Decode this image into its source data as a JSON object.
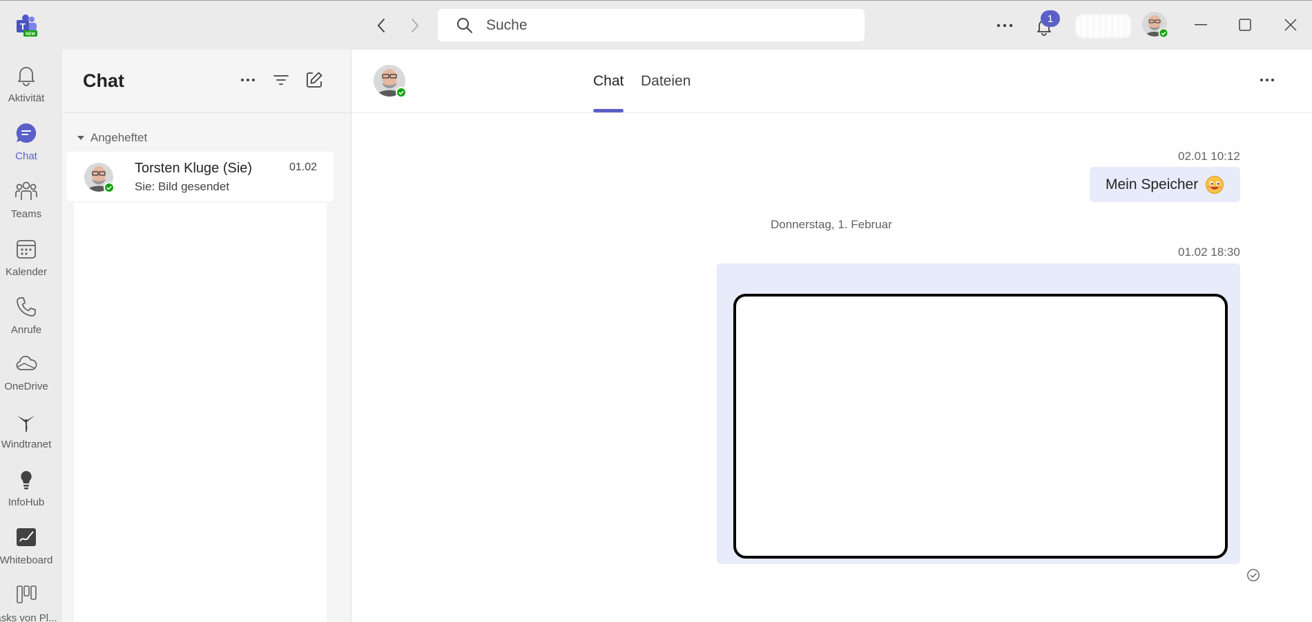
{
  "titlebar": {
    "search_placeholder": "Suche",
    "notification_count": "1"
  },
  "rail": {
    "items": [
      {
        "label": "Aktivität"
      },
      {
        "label": "Chat"
      },
      {
        "label": "Teams"
      },
      {
        "label": "Kalender"
      },
      {
        "label": "Anrufe"
      },
      {
        "label": "OneDrive"
      },
      {
        "label": "Windtranet"
      },
      {
        "label": "InfoHub"
      },
      {
        "label": "Whiteboard"
      },
      {
        "label": "asks von Pl..."
      }
    ]
  },
  "list": {
    "title": "Chat",
    "section": "Angeheftet",
    "chats": [
      {
        "name": "Torsten Kluge (Sie)",
        "preview": "Sie: Bild gesendet",
        "time": "01.02"
      }
    ]
  },
  "conversation": {
    "tabs": [
      {
        "label": "Chat"
      },
      {
        "label": "Dateien"
      }
    ],
    "messages": [
      {
        "time": "02.01 10:12",
        "text": "Mein Speicher"
      },
      {
        "time": "01.02 18:30"
      }
    ],
    "date_separator": "Donnerstag, 1. Februar"
  },
  "colors": {
    "accent": "#5b5fc7",
    "bubble": "#e8ebfa",
    "presence": "#13a10e"
  }
}
